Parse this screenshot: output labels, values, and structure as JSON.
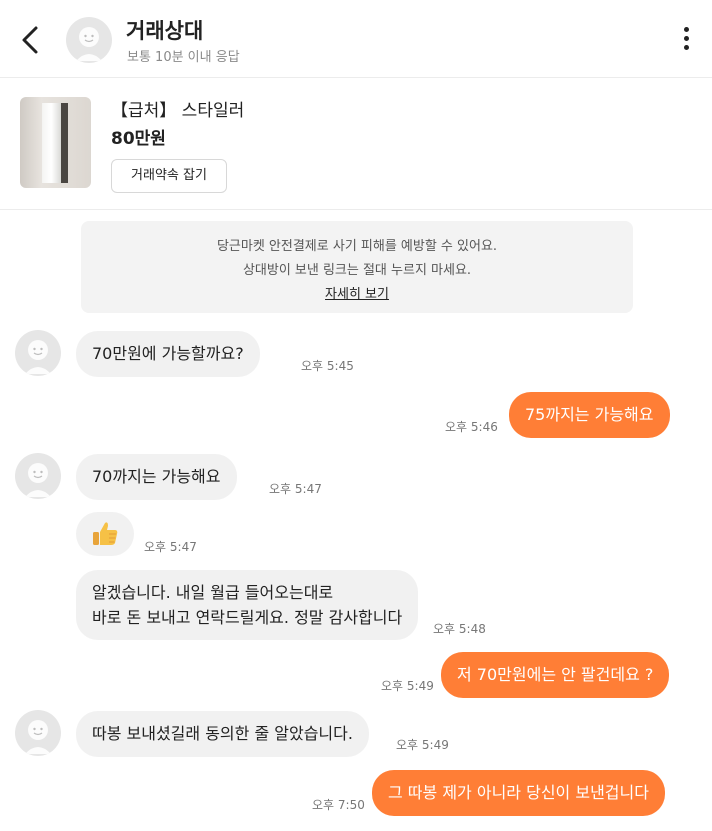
{
  "header": {
    "partner_name": "거래상대",
    "response_note": "보통 10분 이내 응답"
  },
  "product": {
    "title": "【급처】 스타일러",
    "price": "80만원",
    "appointment_button": "거래약속 잡기"
  },
  "notice": {
    "line1": "당근마켓 안전결제로 사기 피해를 예방할 수 있어요.",
    "line2": "상대방이 보낸 링크는 절대 누르지 마세요.",
    "link": "자세히 보기"
  },
  "messages": [
    {
      "side": "in",
      "text": "70만원에 가능할까요?",
      "time": "오후 5:45"
    },
    {
      "side": "out",
      "text": "75까지는 가능해요",
      "time": "오후 5:46"
    },
    {
      "side": "in",
      "text": "70까지는 가능해요",
      "time": "오후 5:47"
    },
    {
      "side": "in",
      "emoji": "thumbs-up-icon",
      "time": "오후 5:47"
    },
    {
      "side": "in",
      "line1": "알겠습니다. 내일 월급 들어오는대로",
      "line2": "바로 돈 보내고 연락드릴게요. 정말 감사합니다",
      "time": "오후 5:48"
    },
    {
      "side": "out",
      "text": "저 70만원에는 안 팔건데요 ?",
      "time": "오후 5:49"
    },
    {
      "side": "in",
      "text": "따봉 보내셨길래 동의한 줄 알았습니다.",
      "time": "오후 5:49"
    },
    {
      "side": "out",
      "text": "그 따봉 제가 아니라 당신이 보낸겁니다",
      "time": "오후 7:50"
    }
  ],
  "colors": {
    "accent": "#ff7e36",
    "incoming_bubble": "#f1f1f1",
    "notice_bg": "#f3f3f3"
  }
}
